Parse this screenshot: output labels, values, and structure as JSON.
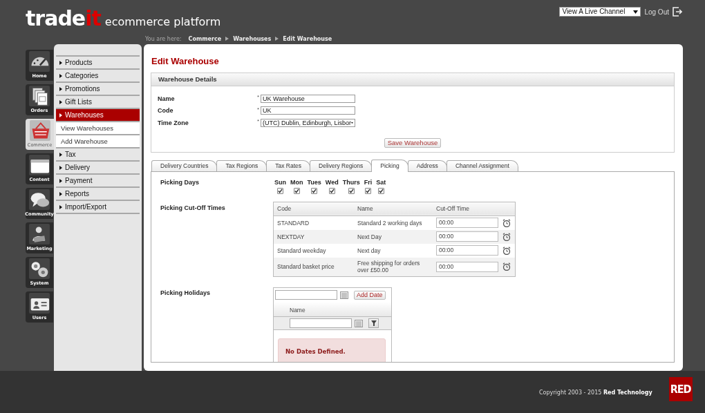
{
  "header": {
    "logo_main": "trade",
    "logo_accent": "it",
    "tagline": "ecommerce platform",
    "channel_select": "View A Live Channel",
    "logout": "Log Out"
  },
  "breadcrumb": {
    "label": "You are here:",
    "items": [
      "Commerce",
      "Warehouses",
      "Edit Warehouse"
    ]
  },
  "nav_rail": [
    {
      "label": "Home",
      "kind": "home",
      "selected": false
    },
    {
      "label": "Orders",
      "kind": "orders",
      "selected": false
    },
    {
      "label": "Commerce",
      "kind": "commerce",
      "selected": true
    },
    {
      "label": "Content",
      "kind": "content",
      "selected": false
    },
    {
      "label": "Community",
      "kind": "community",
      "selected": false
    },
    {
      "label": "Marketing",
      "kind": "marketing",
      "selected": false
    },
    {
      "label": "System",
      "kind": "system",
      "selected": false
    },
    {
      "label": "Users",
      "kind": "users",
      "selected": false
    }
  ],
  "menu": [
    {
      "label": "Products",
      "selected": false
    },
    {
      "label": "Categories",
      "selected": false
    },
    {
      "label": "Promotions",
      "selected": false
    },
    {
      "label": "Gift Lists",
      "selected": false
    },
    {
      "label": "Warehouses",
      "selected": true,
      "children": [
        {
          "label": "View Warehouses",
          "selected": false
        },
        {
          "label": "Add Warehouse",
          "selected": false
        }
      ]
    },
    {
      "label": "Tax",
      "selected": false
    },
    {
      "label": "Delivery",
      "selected": false
    },
    {
      "label": "Payment",
      "selected": false
    },
    {
      "label": "Reports",
      "selected": false
    },
    {
      "label": "Import/Export",
      "selected": false
    }
  ],
  "page_title": "Edit Warehouse",
  "details": {
    "title": "Warehouse Details",
    "fields": [
      {
        "label": "Name",
        "kind": "text",
        "marker": "*",
        "value": "UK Warehouse"
      },
      {
        "label": "Code",
        "kind": "text",
        "marker": "*",
        "value": "UK"
      },
      {
        "label": "Time Zone",
        "kind": "select",
        "marker": "*",
        "value": "(UTC) Dublin, Edinburgh, Lisbor"
      }
    ],
    "save_button": "Save Warehouse"
  },
  "tabs": [
    {
      "label": "Delivery Countries",
      "selected": false
    },
    {
      "label": "Tax Regions",
      "selected": false
    },
    {
      "label": "Tax Rates",
      "selected": false
    },
    {
      "label": "Delivery Regions",
      "selected": false
    },
    {
      "label": "Picking",
      "selected": true
    },
    {
      "label": "Address",
      "selected": false
    },
    {
      "label": "Channel Assignment",
      "selected": false
    }
  ],
  "picking": {
    "days_label": "Picking Days",
    "days": [
      {
        "label": "Sun",
        "checked": true
      },
      {
        "label": "Mon",
        "checked": true
      },
      {
        "label": "Tues",
        "checked": true
      },
      {
        "label": "Wed",
        "checked": true
      },
      {
        "label": "Thurs",
        "checked": true
      },
      {
        "label": "Fri",
        "checked": true
      },
      {
        "label": "Sat",
        "checked": true
      }
    ],
    "cutoff_label": "Picking Cut-Off Times",
    "cutoff_table": {
      "columns": [
        "Code",
        "Name",
        "Cut-Off Time"
      ],
      "rows": [
        {
          "code": "STANDARD",
          "name": "Standard 2 working days",
          "time": "00:00"
        },
        {
          "code": "NEXTDAY",
          "name": "Next Day",
          "time": "00:00"
        },
        {
          "code": "Standard weekday",
          "name": "Next day",
          "time": "00:00"
        },
        {
          "code": "Standard basket price",
          "name": "Free shipping for orders over £50.00",
          "time": "00:00"
        }
      ]
    },
    "holidays_label": "Picking Holidays",
    "holidays": {
      "add_button": "Add Date",
      "column": "Name",
      "empty_message": "No Dates Defined."
    }
  },
  "footer": {
    "copyright": "Copyright 2003 - 2015 **Red Technology**",
    "logo": "RED"
  }
}
